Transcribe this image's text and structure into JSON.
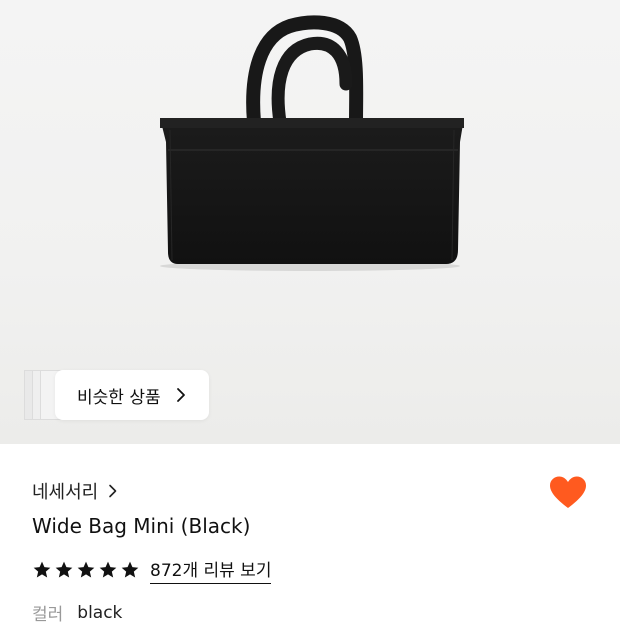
{
  "hero": {
    "image": "black-wide-leather-tote-bag",
    "similar_button_label": "비슷한 상품"
  },
  "product": {
    "brand": "네세서리",
    "title": "Wide Bag Mini (Black)",
    "rating": 5,
    "review_link": "872개 리뷰 보기",
    "color_label": "컬러",
    "color_value": "black",
    "wishlisted": true
  },
  "colors": {
    "heart": "#ff5a1f",
    "star": "#111111",
    "bag": "#161616"
  },
  "icons": {
    "brand_chevron": "chevron-right-icon",
    "similar_chevron": "chevron-right-icon",
    "wishlist": "heart-icon",
    "rating": "star-icon"
  }
}
